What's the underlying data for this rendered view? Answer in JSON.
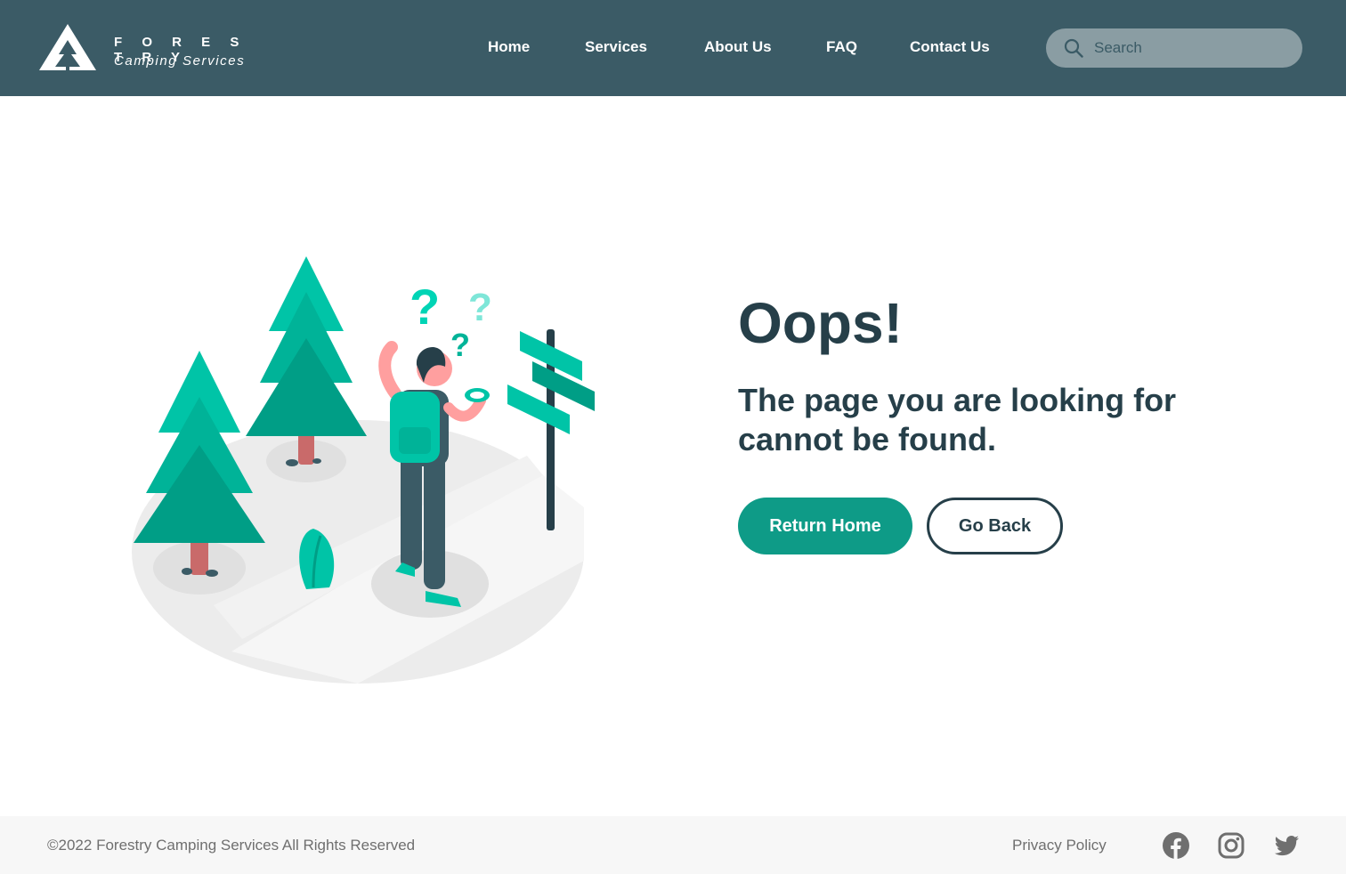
{
  "brand": {
    "name": "F O R E S T R Y",
    "tagline": "Camping Services"
  },
  "nav": {
    "home": "Home",
    "services": "Services",
    "about": "About Us",
    "faq": "FAQ",
    "contact": "Contact Us"
  },
  "search": {
    "placeholder": "Search",
    "value": ""
  },
  "main": {
    "heading": "Oops!",
    "message": "The page you are looking for cannot be found.",
    "return_home_label": "Return Home",
    "go_back_label": "Go Back"
  },
  "footer": {
    "copyright": "©2022 Forestry Camping Services All Rights Reserved",
    "privacy_label": "Privacy Policy"
  },
  "icons": {
    "logo": "tent-tree-logo-icon",
    "search": "search-icon",
    "facebook": "facebook-icon",
    "instagram": "instagram-icon",
    "twitter": "twitter-icon"
  },
  "colors": {
    "header_bg": "#3b5b66",
    "primary": "#0e9b87",
    "accent": "#00c4a7",
    "text_dark": "#263f49",
    "footer_bg": "#f7f7f7",
    "footer_text": "#6f6f6f"
  }
}
